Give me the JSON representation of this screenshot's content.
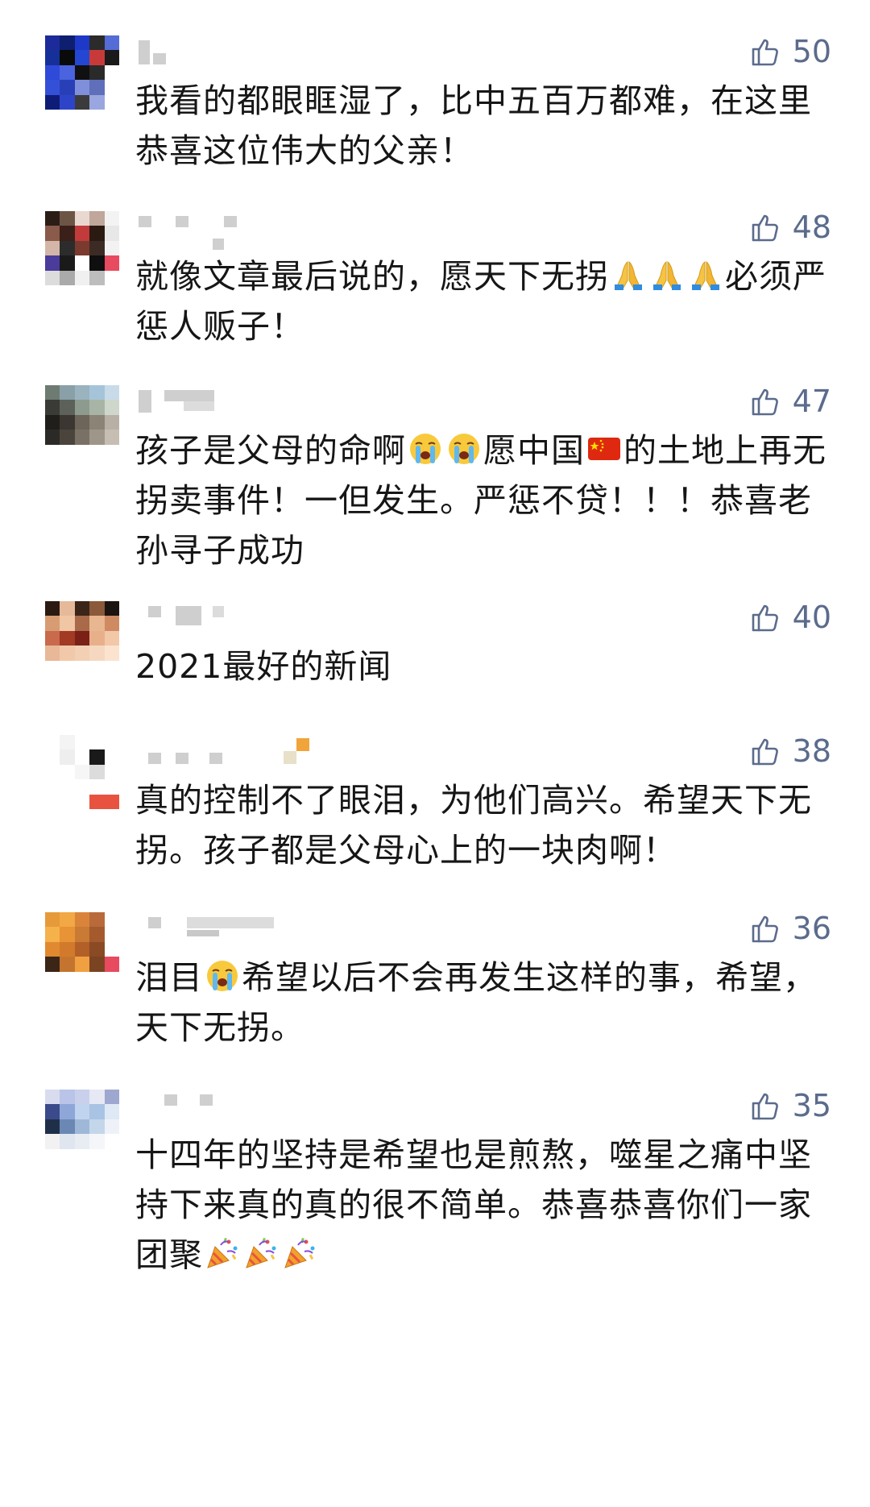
{
  "comments": [
    {
      "likes": "50",
      "text": "我看的都眼眶湿了，比中五百万都难，在这里恭喜这位伟大的父亲！",
      "avatar_colors": [
        "#1d2a9a",
        "#0d1f6e",
        "#1e39c7",
        "#2b2b2b",
        "#556bd6",
        "#16309a",
        "#0a0a0a",
        "#2447d3",
        "#c83a3a",
        "#1a1a1a",
        "#2f49d8",
        "#4a63de",
        "#101010",
        "#2a2a2a",
        "#ffffff",
        "#3550d8",
        "#283fb8",
        "#7f8fd9",
        "#5f6fb9",
        "#ffffff",
        "#0e1c77",
        "#2d44c9",
        "#3b3b3b",
        "#9aa6e0",
        "#ffffff"
      ]
    },
    {
      "likes": "48",
      "text_before": "就像文章最后说的，愿天下无拐",
      "emojis_mid": [
        "folded-hands-emoji",
        "folded-hands-emoji",
        "folded-hands-emoji"
      ],
      "text_after": "必须严惩人贩子！",
      "avatar_colors": [
        "#2b1d16",
        "#6d5546",
        "#e9d8d0",
        "#c0a69b",
        "#f3f3f3",
        "#8a5a4a",
        "#3a2018",
        "#c23b3b",
        "#2a1a12",
        "#e7e7e7",
        "#d4b6a8",
        "#2c2c2c",
        "#7a3a2e",
        "#3b2b24",
        "#f2f2f2",
        "#4b3b9a",
        "#1a1a1a",
        "#ffffff",
        "#0f0f0f",
        "#e84a5f",
        "#dcdcdc",
        "#aaaaaa",
        "#f0f0f0",
        "#bdbdbd",
        "#ffffff"
      ]
    },
    {
      "likes": "47",
      "text_1": "孩子是父母的命啊",
      "text_2": "愿中国",
      "text_3": "的土地上再无拐卖事件！一但发生。严惩不贷！！！恭喜老孙寻子成功",
      "avatar_colors": [
        "#6d7b73",
        "#8aa0a8",
        "#9bb2bf",
        "#a6c4d9",
        "#c9dbe8",
        "#3a3a36",
        "#5c6159",
        "#8d9a8e",
        "#a8b5a6",
        "#cfd7cc",
        "#1f1e1b",
        "#3b3631",
        "#6e655a",
        "#8c8377",
        "#b8b0a5",
        "#2c2a26",
        "#4a443c",
        "#7a7166",
        "#9f968a",
        "#c6beb3",
        "#ffffff",
        "#ffffff",
        "#ffffff",
        "#ffffff",
        "#ffffff"
      ]
    },
    {
      "likes": "40",
      "text": "2021最好的新闻",
      "avatar_colors": [
        "#2b1a12",
        "#e6b99a",
        "#3b2518",
        "#8a5a3a",
        "#1b1410",
        "#d89c72",
        "#f0c6a4",
        "#a86a48",
        "#e8b690",
        "#d08a62",
        "#c96a4c",
        "#a23a24",
        "#7a2016",
        "#e8b08a",
        "#f2c8a8",
        "#e8b898",
        "#f1c9aa",
        "#f3d0b4",
        "#f6d8c0",
        "#fbe3cf",
        "#ffffff",
        "#ffffff",
        "#ffffff",
        "#ffffff",
        "#ffffff"
      ]
    },
    {
      "likes": "38",
      "text": "真的控制不了眼泪，为他们高兴。希望天下无拐。孩子都是父母心上的一块肉啊！",
      "avatar_colors": [
        "#ffffff",
        "#f4f4f4",
        "#ffffff",
        "#ffffff",
        "#ffffff",
        "#ffffff",
        "#eeeeee",
        "#ffffff",
        "#1a1a1a",
        "#ffffff",
        "#ffffff",
        "#ffffff",
        "#f6f6f6",
        "#dcdcdc",
        "#ffffff",
        "#ffffff",
        "#ffffff",
        "#ffffff",
        "#ffffff",
        "#ffffff",
        "#ffffff",
        "#ffffff",
        "#ffffff",
        "#e8533f",
        "#e8533f"
      ]
    },
    {
      "likes": "36",
      "text_1": "泪目",
      "text_2": "希望以后不会再发生这样的事，希望，天下无拐。",
      "avatar_colors": [
        "#e79a3a",
        "#f2a845",
        "#d9843a",
        "#b86a3a",
        "#ffffff",
        "#f5b24a",
        "#e89336",
        "#c97a34",
        "#a45a2c",
        "#ffffff",
        "#e1892f",
        "#d27a2c",
        "#b35f28",
        "#8a4a24",
        "#ffffff",
        "#3a2516",
        "#c4742e",
        "#f0a040",
        "#7a4422",
        "#e84a5f",
        "#ffffff",
        "#ffffff",
        "#ffffff",
        "#ffffff",
        "#ffffff"
      ]
    },
    {
      "likes": "35",
      "text_1": "十四年的坚持是希望也是煎熬，噬星之痛中坚持下来真的真的很不简单。恭喜恭喜你们一家团聚",
      "emojis_end": [
        "party-popper-emoji",
        "party-popper-emoji",
        "party-popper-emoji"
      ],
      "avatar_colors": [
        "#d9dcef",
        "#b9c4e8",
        "#c9d0ec",
        "#e6e8f4",
        "#9ea7d0",
        "#3b4a8a",
        "#8ea6d8",
        "#c0d4ef",
        "#a9c3e4",
        "#dfe8f5",
        "#1f2f4a",
        "#6b88b4",
        "#9fb8d8",
        "#c4d6ea",
        "#eef2f8",
        "#f2f2f2",
        "#dfe6ef",
        "#e8edf4",
        "#f4f6f9",
        "#ffffff",
        "#ffffff",
        "#ffffff",
        "#ffffff",
        "#ffffff",
        "#ffffff"
      ]
    }
  ],
  "icons": {
    "like": "thumbs-up-icon"
  },
  "colors": {
    "like_count": "#5b6b8c",
    "text": "#161616",
    "name_placeholder": "#cfcfcf"
  }
}
